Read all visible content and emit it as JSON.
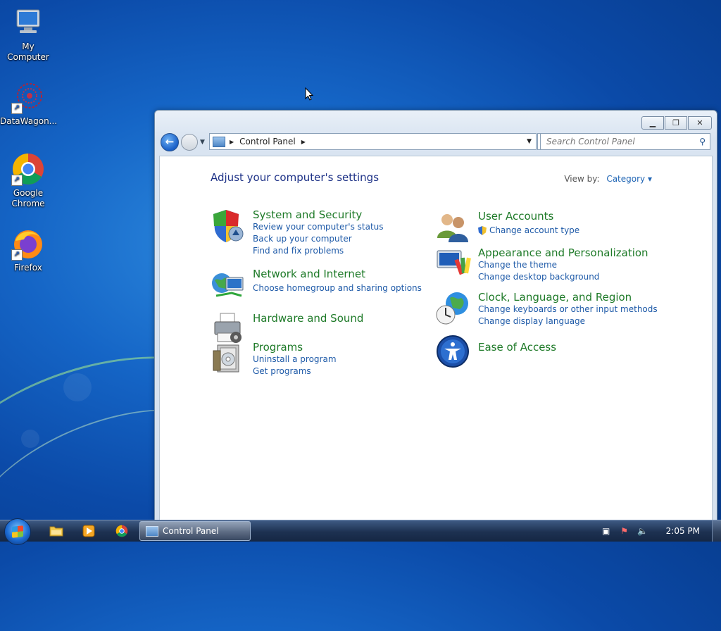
{
  "desktop": {
    "icons": [
      {
        "label": "My Computer",
        "icon": "computer-icon"
      },
      {
        "label": "DataWagon...",
        "icon": "datawagon-icon"
      },
      {
        "label": "Google Chrome",
        "icon": "chrome-icon"
      },
      {
        "label": "Firefox",
        "icon": "firefox-icon"
      }
    ]
  },
  "window": {
    "title": "Control Panel",
    "breadcrumb": "Control Panel",
    "search_placeholder": "Search Control Panel",
    "heading": "Adjust your computer's settings",
    "view_by_label": "View by:",
    "view_by_value": "Category",
    "left_categories": [
      {
        "title": "System and Security",
        "icon": "shield-icon",
        "links": [
          "Review your computer's status",
          "Back up your computer",
          "Find and fix problems"
        ]
      },
      {
        "title": "Network and Internet",
        "icon": "network-globe-icon",
        "links": [
          "Choose homegroup and sharing options"
        ]
      },
      {
        "title": "Hardware and Sound",
        "icon": "printer-icon",
        "links": []
      },
      {
        "title": "Programs",
        "icon": "programs-icon",
        "links": [
          "Uninstall a program",
          "Get programs"
        ]
      }
    ],
    "right_categories": [
      {
        "title": "User Accounts",
        "icon": "users-icon",
        "links": [
          "Change account type"
        ]
      },
      {
        "title": "Appearance and Personalization",
        "icon": "monitor-palette-icon",
        "links": [
          "Change the theme",
          "Change desktop background"
        ]
      },
      {
        "title": "Clock, Language, and Region",
        "icon": "clock-globe-icon",
        "links": [
          "Change keyboards or other input methods",
          "Change display language"
        ]
      },
      {
        "title": "Ease of Access",
        "icon": "ease-of-access-icon",
        "links": []
      }
    ]
  },
  "taskbar": {
    "active_app": "Control Panel",
    "clock": "2:05 PM"
  },
  "colors": {
    "category_title": "#1e7a28",
    "link": "#1e5aa8",
    "heading": "#1e3287"
  }
}
